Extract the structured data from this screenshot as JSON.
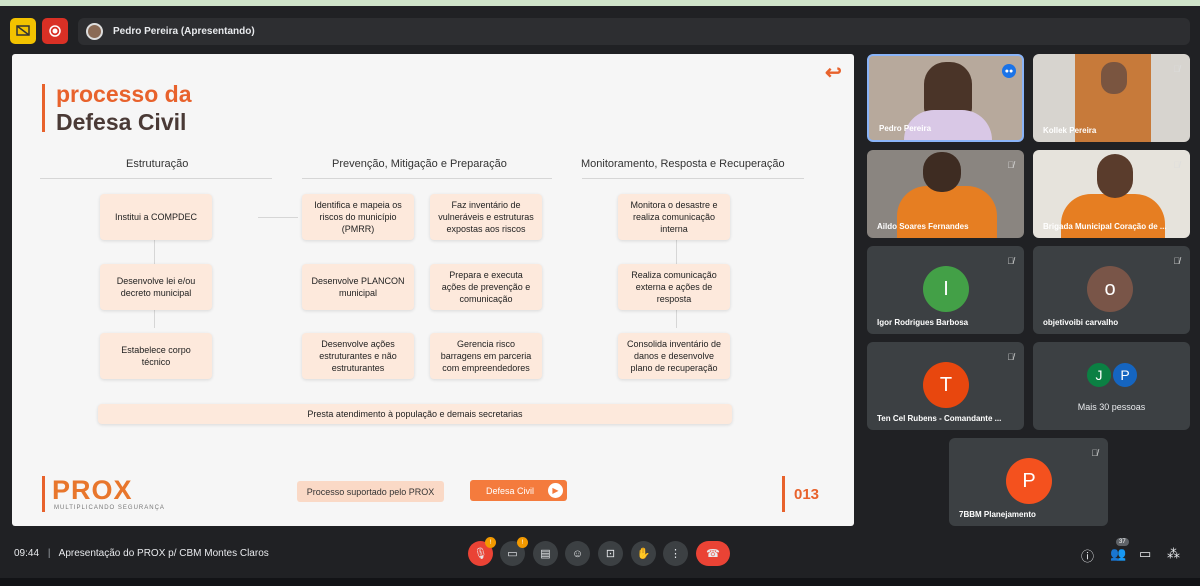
{
  "meet": {
    "presenter_label": "Pedro Pereira (Apresentando)",
    "time": "09:44",
    "separator": "|",
    "meeting_title": "Apresentação do PROX p/ CBM Montes Claros",
    "participant_count": "37"
  },
  "slide": {
    "title_line1": "processo da",
    "title_line2": "Defesa Civil",
    "columns": [
      "Estruturação",
      "Prevenção, Mitigação e Preparação",
      "Monitoramento, Resposta e Recuperação"
    ],
    "col1": [
      "Institui a COMPDEC",
      "Desenvolve lei e/ou decreto municipal",
      "Estabelece corpo técnico"
    ],
    "col2a": [
      "Identifica e mapeia os riscos do município (PMRR)",
      "Desenvolve PLANCON municipal",
      "Desenvolve ações estruturantes e não estruturantes"
    ],
    "col2b": [
      "Faz inventário de vulneráveis e estruturas expostas aos riscos",
      "Prepara e executa ações de prevenção e comunicação",
      "Gerencia risco barragens em parceria com empreendedores"
    ],
    "col3": [
      "Monitora o desastre e realiza comunicação interna",
      "Realiza comunicação externa e ações de resposta",
      "Consolida inventário de danos e desenvolve plano de recuperação"
    ],
    "footer_box": "Presta atendimento à população e demais secretarias",
    "logo": "PROX",
    "logo_sub": "MULTIPLICANDO SEGURANÇA",
    "btn_process": "Processo suportado pelo PROX",
    "btn_defesa": "Defesa Civil",
    "page": "013"
  },
  "participants": [
    {
      "name": "Pedro Pereira"
    },
    {
      "name": "Kollek Pereira"
    },
    {
      "name": "Aildo Soares Fernandes"
    },
    {
      "name": "Brigada Municipal Coração de ..."
    },
    {
      "name": "Igor Rodrigues Barbosa",
      "initial": "I",
      "color": "#43a047"
    },
    {
      "name": "objetivoibi carvalho",
      "initial": "o",
      "color": "#795548"
    },
    {
      "name": "Ten Cel Rubens - Comandante ...",
      "initial": "T",
      "color": "#e8470e"
    },
    {
      "name": "7BBM Planejamento",
      "initial": "P",
      "color": "#f4511e"
    }
  ],
  "more_people": {
    "label": "Mais 30 pessoas",
    "initials": [
      "J",
      "P"
    ],
    "colors": [
      "#0b8043",
      "#1565c0"
    ]
  },
  "colors": {
    "accent": "#e8622c",
    "meet_bg": "#202124",
    "leave": "#ea4335"
  },
  "icons": [
    "present-icon",
    "record-icon",
    "mic-off-icon",
    "camera-off-icon",
    "captions-icon",
    "emoji-icon",
    "present-screen-icon",
    "raise-hand-icon",
    "more-icon",
    "hang-up-icon",
    "info-icon",
    "people-icon",
    "chat-icon",
    "activities-icon"
  ],
  "badges": {
    "mic": "!",
    "camera": "!"
  }
}
